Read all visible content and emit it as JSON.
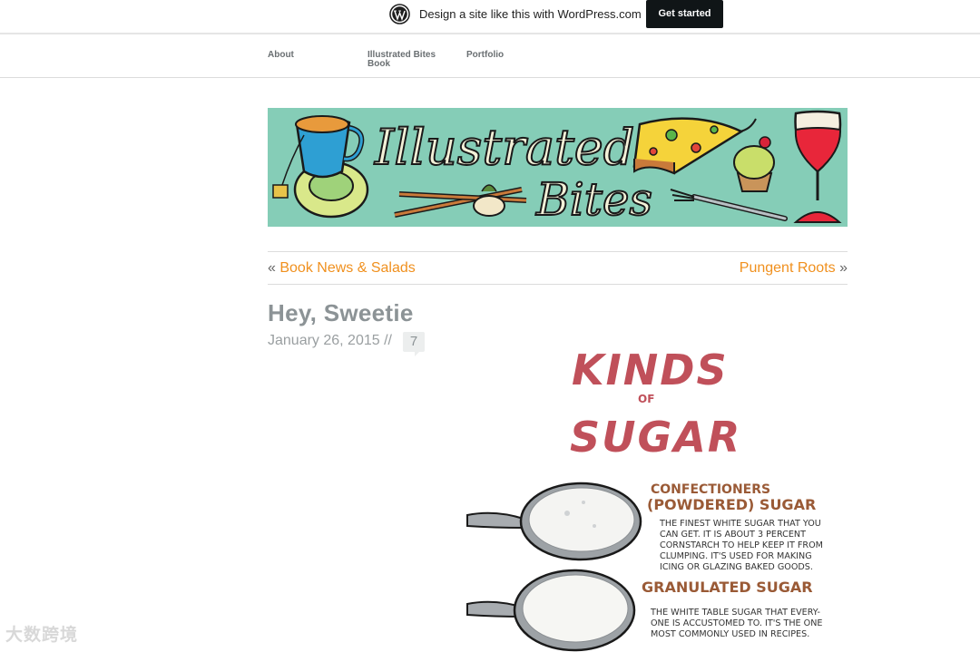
{
  "wpbar": {
    "logo_icon": "wordpress-logo-icon",
    "promo_text": "Design a site like this with WordPress.com",
    "cta_label": "Get started"
  },
  "nav": {
    "items": [
      {
        "label": "About"
      },
      {
        "label": "Illustrated Bites Book"
      },
      {
        "label": "Portfolio"
      }
    ]
  },
  "banner": {
    "title_line1": "Illustrated",
    "title_line2": "Bites",
    "bg_color": "#85cdb7"
  },
  "post_nav": {
    "prev_arrow": "«",
    "prev_label": "Book News & Salads",
    "next_label": "Pungent Roots",
    "next_arrow": "»",
    "link_color": "#f0901e"
  },
  "post": {
    "title": "Hey, Sweetie",
    "date": "January 26, 2015 //",
    "comment_count": "7"
  },
  "infographic": {
    "heading_line1": "KINDS",
    "heading_of": "OF",
    "heading_line2": "SUGAR",
    "items": [
      {
        "name_line1": "CONFECTIONERS",
        "name_line2": "(POWDERED) SUGAR",
        "desc": [
          "THE FINEST WHITE SUGAR THAT YOU",
          "CAN GET. IT IS ABOUT 3 PERCENT",
          "CORNSTARCH TO HELP KEEP IT FROM",
          "CLUMPING. IT'S USED FOR MAKING",
          "ICING OR GLAZING BAKED GOODS."
        ]
      },
      {
        "name_line1": "GRANULATED SUGAR",
        "desc": [
          "THE WHITE TABLE SUGAR THAT EVERY-",
          "ONE IS ACCUSTOMED TO. IT'S THE ONE",
          "MOST COMMONLY USED IN RECIPES."
        ]
      }
    ]
  },
  "watermark": {
    "text": "大数跨境"
  }
}
